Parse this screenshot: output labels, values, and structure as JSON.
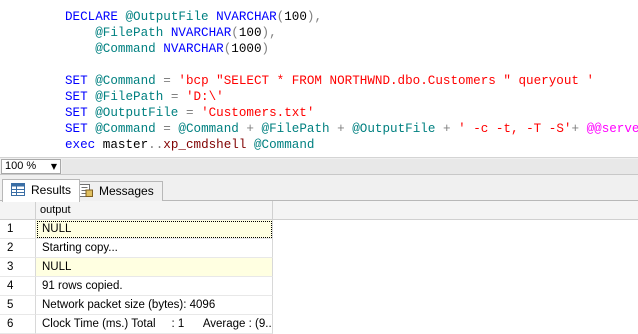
{
  "editor": {
    "lines": [
      [
        {
          "c": "kw",
          "t": "DECLARE "
        },
        {
          "c": "var",
          "t": "@OutputFile "
        },
        {
          "c": "typ",
          "t": "NVARCHAR"
        },
        {
          "c": "op",
          "t": "("
        },
        {
          "c": "pl",
          "t": "100"
        },
        {
          "c": "op",
          "t": "),"
        }
      ],
      [
        {
          "c": "pl",
          "t": "    "
        },
        {
          "c": "var",
          "t": "@FilePath "
        },
        {
          "c": "typ",
          "t": "NVARCHAR"
        },
        {
          "c": "op",
          "t": "("
        },
        {
          "c": "pl",
          "t": "100"
        },
        {
          "c": "op",
          "t": "),"
        }
      ],
      [
        {
          "c": "pl",
          "t": "    "
        },
        {
          "c": "var",
          "t": "@Command "
        },
        {
          "c": "typ",
          "t": "NVARCHAR"
        },
        {
          "c": "op",
          "t": "("
        },
        {
          "c": "pl",
          "t": "1000"
        },
        {
          "c": "op",
          "t": ")"
        }
      ],
      [],
      [
        {
          "c": "kw",
          "t": "SET "
        },
        {
          "c": "var",
          "t": "@Command "
        },
        {
          "c": "op",
          "t": "= "
        },
        {
          "c": "str",
          "t": "'bcp \"SELECT * FROM NORTHWND.dbo.Customers \" queryout '"
        }
      ],
      [
        {
          "c": "kw",
          "t": "SET "
        },
        {
          "c": "var",
          "t": "@FilePath "
        },
        {
          "c": "op",
          "t": "= "
        },
        {
          "c": "str",
          "t": "'D:\\'"
        }
      ],
      [
        {
          "c": "kw",
          "t": "SET "
        },
        {
          "c": "var",
          "t": "@OutputFile "
        },
        {
          "c": "op",
          "t": "= "
        },
        {
          "c": "str",
          "t": "'Customers.txt'"
        }
      ],
      [
        {
          "c": "kw",
          "t": "SET "
        },
        {
          "c": "var",
          "t": "@Command "
        },
        {
          "c": "op",
          "t": "= "
        },
        {
          "c": "var",
          "t": "@Command "
        },
        {
          "c": "op",
          "t": "+ "
        },
        {
          "c": "var",
          "t": "@FilePath "
        },
        {
          "c": "op",
          "t": "+ "
        },
        {
          "c": "var",
          "t": "@OutputFile "
        },
        {
          "c": "op",
          "t": "+ "
        },
        {
          "c": "str",
          "t": "' -c -t, -T -S'"
        },
        {
          "c": "op",
          "t": "+ "
        },
        {
          "c": "sys",
          "t": "@@servername"
        }
      ],
      [
        {
          "c": "kw",
          "t": "exec "
        },
        {
          "c": "pl",
          "t": "master"
        },
        {
          "c": "op",
          "t": ".."
        },
        {
          "c": "fn",
          "t": "xp_cmdshell "
        },
        {
          "c": "var",
          "t": "@Command"
        }
      ]
    ]
  },
  "zoom": {
    "value": "100 %",
    "arrow": "▼"
  },
  "tabs": [
    {
      "label": "Results",
      "icon": "grid-icon",
      "active": true
    },
    {
      "label": "Messages",
      "icon": "messages-icon",
      "active": false
    }
  ],
  "grid": {
    "column": "output",
    "rows": [
      {
        "num": "1",
        "value": "NULL",
        "null": true,
        "selected": true
      },
      {
        "num": "2",
        "value": "Starting copy...",
        "null": false,
        "selected": false
      },
      {
        "num": "3",
        "value": "NULL",
        "null": true,
        "selected": false
      },
      {
        "num": "4",
        "value": "91 rows copied.",
        "null": false,
        "selected": false
      },
      {
        "num": "5",
        "value": "Network packet size (bytes): 4096",
        "null": false,
        "selected": false
      },
      {
        "num": "6",
        "value": "Clock Time (ms.) Total     : 1      Average : (9...",
        "null": false,
        "selected": false
      }
    ]
  },
  "colors": {
    "keyword": "#0000ff",
    "variable": "#008080",
    "string": "#ff0000",
    "system_variable": "#ff00ff",
    "function": "#800000",
    "null_cell": "#ffffe1"
  }
}
